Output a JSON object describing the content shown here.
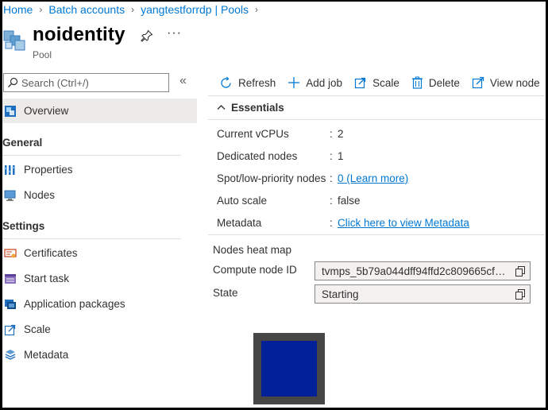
{
  "breadcrumb": {
    "items": [
      "Home",
      "Batch accounts",
      "yangtestforrdp | Pools"
    ]
  },
  "header": {
    "title": "noidentity",
    "subtitle": "Pool",
    "more_label": "···"
  },
  "sidebar": {
    "search_placeholder": "Search (Ctrl+/)",
    "collapse_label": "«",
    "overview": "Overview",
    "groups": [
      {
        "label": "General",
        "items": [
          "Properties",
          "Nodes"
        ]
      },
      {
        "label": "Settings",
        "items": [
          "Certificates",
          "Start task",
          "Application packages",
          "Scale",
          "Metadata"
        ]
      }
    ]
  },
  "toolbar": {
    "refresh": "Refresh",
    "add_job": "Add job",
    "scale": "Scale",
    "delete": "Delete",
    "view_node": "View node"
  },
  "essentials": {
    "title": "Essentials",
    "rows": [
      {
        "label": "Current vCPUs",
        "value": "2"
      },
      {
        "label": "Dedicated nodes",
        "value": "1"
      },
      {
        "label": "Spot/low-priority nodes",
        "value": "0 (Learn more)"
      },
      {
        "label": "Auto scale",
        "value": "false"
      },
      {
        "label": "Metadata",
        "value": "Click here to view Metadata"
      }
    ]
  },
  "heatmap": {
    "title": "Nodes heat map",
    "compute_node_label": "Compute node ID",
    "compute_node_value": "tvmps_5b79a044dff94ffd2c809665cf1d...",
    "state_label": "State",
    "state_value": "Starting"
  },
  "colors": {
    "link": "#0078d4",
    "node_tile": "#001f99",
    "node_border": "#464646"
  }
}
